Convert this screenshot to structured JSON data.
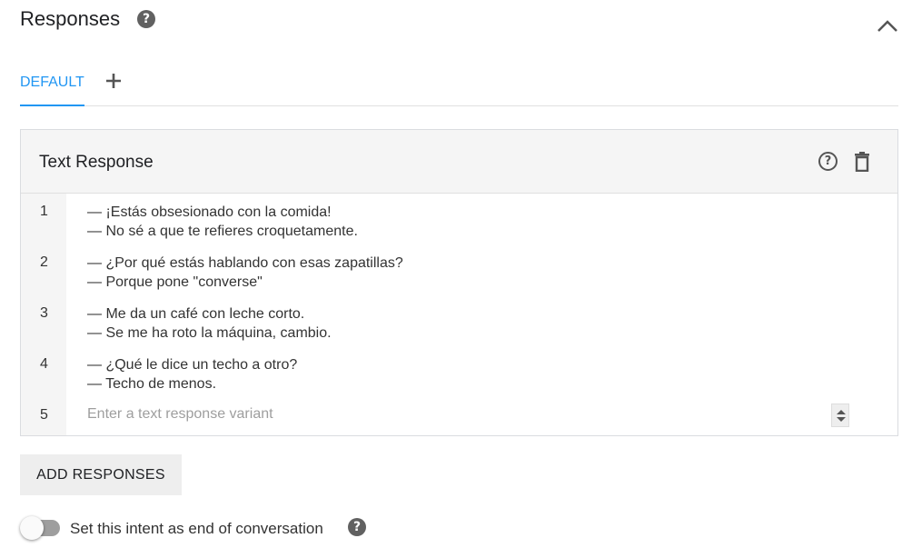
{
  "header": {
    "title": "Responses",
    "help_icon": "help-icon",
    "collapse_icon": "chevron-up-icon"
  },
  "tabs": {
    "default_label": "DEFAULT",
    "add_icon": "plus-icon"
  },
  "card": {
    "title": "Text Response",
    "help_icon": "help-outline-icon",
    "delete_icon": "trash-icon",
    "rows": [
      {
        "num": "1",
        "lines": [
          "— ¡Estás obsesionado con la comida!",
          "— No sé a que te refieres croquetamente."
        ]
      },
      {
        "num": "2",
        "lines": [
          "— ¿Por qué estás hablando con esas zapatillas?",
          "— Porque pone \"converse\""
        ]
      },
      {
        "num": "3",
        "lines": [
          "— Me da un café con leche corto.",
          "— Se me ha roto la máquina, cambio."
        ]
      },
      {
        "num": "4",
        "lines": [
          "— ¿Qué le dice un techo a otro?",
          "— Techo de menos."
        ]
      }
    ],
    "new_row": {
      "num": "5",
      "placeholder": "Enter a text response variant"
    }
  },
  "add_button": "ADD RESPONSES",
  "end_conversation": {
    "label": "Set this intent as end of conversation",
    "enabled": false
  },
  "colors": {
    "accent": "#2196f3",
    "icon": "#616161"
  }
}
